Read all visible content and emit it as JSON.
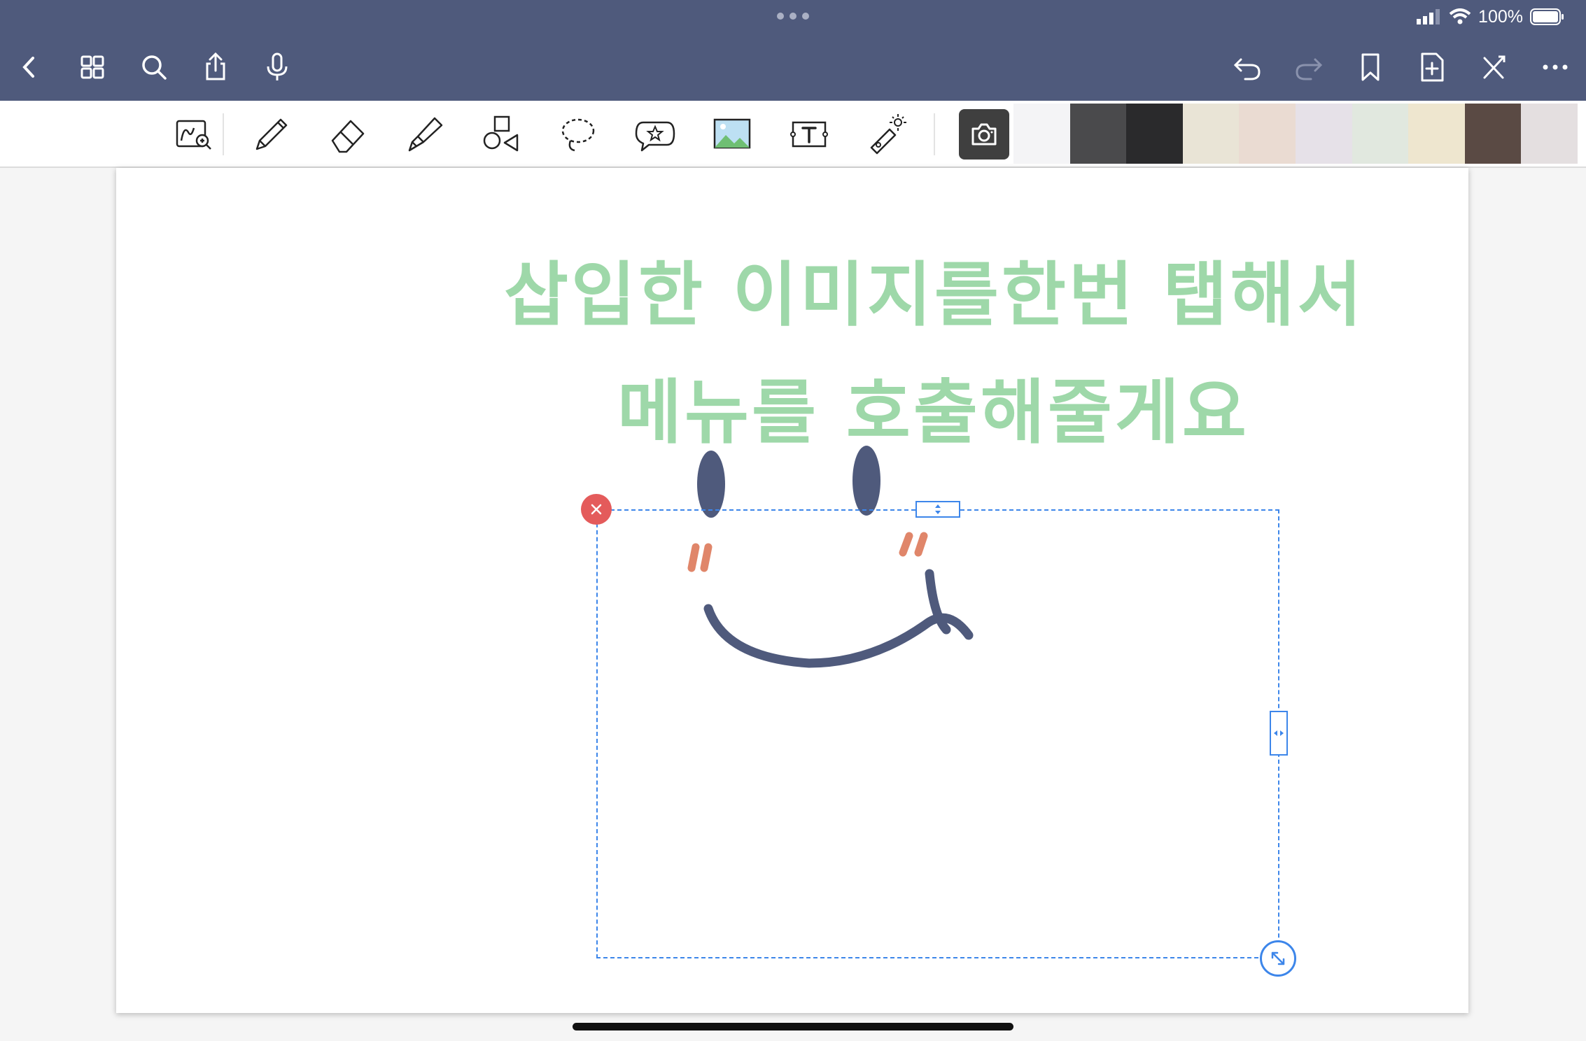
{
  "status_bar": {
    "battery": "100%"
  },
  "nav": {
    "left_icons": [
      "back-icon",
      "grid-icon",
      "search-icon",
      "share-icon",
      "microphone-icon"
    ],
    "right_icons": [
      "undo-icon",
      "redo-icon",
      "bookmark-icon",
      "add-page-icon",
      "pen-off-icon",
      "more-icon"
    ]
  },
  "toolbar": {
    "tools": [
      "zoom-window-icon",
      "pencil-icon",
      "eraser-icon",
      "highlighter-icon",
      "shapes-icon",
      "lasso-icon",
      "sticker-icon",
      "image-icon",
      "text-icon",
      "laser-pointer-icon"
    ],
    "camera_icon": "camera-icon"
  },
  "page": {
    "handwriting_line1": "삽입한 이미지를한번 탭해서",
    "handwriting_line2": "메뉴를 호출해줄게요",
    "handwriting_color": "#9ed8a9",
    "smiley_color": "#4f5a7c",
    "blush_color": "#e0866a",
    "selection_color": "#3d86ea",
    "close_handle_color": "#e45b5b"
  }
}
